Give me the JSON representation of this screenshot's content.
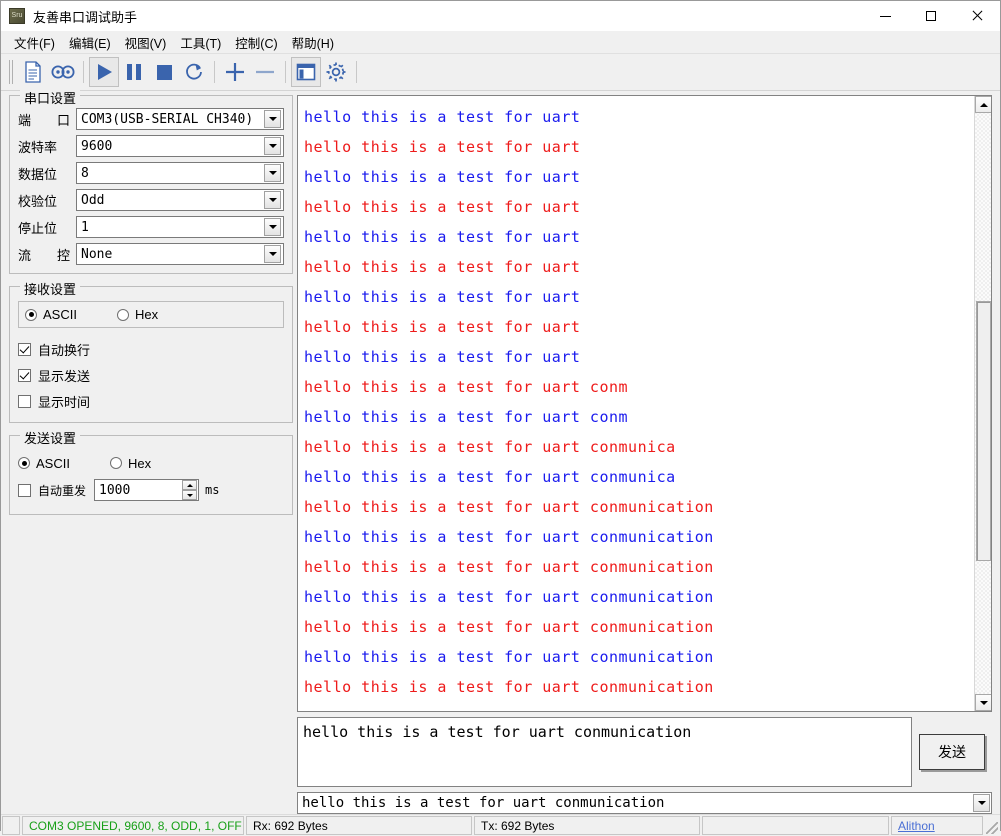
{
  "window": {
    "title": "友善串口调试助手",
    "icon": "app-icon",
    "minimize_label": "minimize",
    "maximize_label": "maximize",
    "close_label": "close"
  },
  "menubar": {
    "items": [
      {
        "label": "文件(F)",
        "name": "menu-file"
      },
      {
        "label": "编辑(E)",
        "name": "menu-edit"
      },
      {
        "label": "视图(V)",
        "name": "menu-view"
      },
      {
        "label": "工具(T)",
        "name": "menu-tools"
      },
      {
        "label": "控制(C)",
        "name": "menu-control"
      },
      {
        "label": "帮助(H)",
        "name": "menu-help"
      }
    ]
  },
  "toolbar": {
    "items": [
      {
        "icon": "new-file-icon",
        "active": false
      },
      {
        "icon": "serial-port-icon",
        "active": false
      },
      {
        "icon": "play-icon",
        "active": true
      },
      {
        "icon": "pause-icon",
        "active": false
      },
      {
        "icon": "stop-icon",
        "active": false
      },
      {
        "icon": "refresh-icon",
        "active": false
      },
      {
        "icon": "plus-icon",
        "active": false
      },
      {
        "icon": "minus-icon",
        "active": false
      },
      {
        "icon": "layout-icon",
        "active": true
      },
      {
        "icon": "gear-icon",
        "active": false
      }
    ]
  },
  "serial_settings": {
    "title": "串口设置",
    "fields": [
      {
        "label_left": "端",
        "label_right": "口",
        "value": "COM3(USB-SERIAL CH340)",
        "name": "port"
      },
      {
        "label_left": "波特率",
        "label_right": "",
        "value": "9600",
        "name": "baudrate"
      },
      {
        "label_left": "数据位",
        "label_right": "",
        "value": "8",
        "name": "databits"
      },
      {
        "label_left": "校验位",
        "label_right": "",
        "value": "Odd",
        "name": "parity"
      },
      {
        "label_left": "停止位",
        "label_right": "",
        "value": "1",
        "name": "stopbits"
      },
      {
        "label_left": "流",
        "label_right": "控",
        "value": "None",
        "name": "flowcontrol"
      }
    ]
  },
  "receive_settings": {
    "title": "接收设置",
    "format_ascii": "ASCII",
    "format_hex": "Hex",
    "format_selected": "ASCII",
    "checkboxes": [
      {
        "label": "自动换行",
        "checked": true,
        "name": "auto-wrap"
      },
      {
        "label": "显示发送",
        "checked": true,
        "name": "show-send"
      },
      {
        "label": "显示时间",
        "checked": false,
        "name": "show-time"
      }
    ]
  },
  "send_settings": {
    "title": "发送设置",
    "format_ascii": "ASCII",
    "format_hex": "Hex",
    "format_selected": "ASCII",
    "auto_resend_label": "自动重发",
    "auto_resend_checked": false,
    "interval_value": "1000",
    "interval_unit": "ms"
  },
  "terminal": {
    "rx_color": "#1a1aee",
    "tx_color": "#ee1a1a",
    "lines": [
      {
        "text": "hello this is a test for uart",
        "dir": "rx"
      },
      {
        "text": "hello this is a test for uart",
        "dir": "tx"
      },
      {
        "text": "hello this is a test for uart",
        "dir": "rx"
      },
      {
        "text": "hello this is a test for uart",
        "dir": "tx"
      },
      {
        "text": "hello this is a test for uart",
        "dir": "rx"
      },
      {
        "text": "hello this is a test for uart",
        "dir": "tx"
      },
      {
        "text": "hello this is a test for uart",
        "dir": "rx"
      },
      {
        "text": "hello this is a test for uart",
        "dir": "tx"
      },
      {
        "text": "hello this is a test for uart",
        "dir": "rx"
      },
      {
        "text": "hello this is a test for uart conm",
        "dir": "tx"
      },
      {
        "text": "hello this is a test for uart conm",
        "dir": "rx"
      },
      {
        "text": "hello this is a test for uart conmunica",
        "dir": "tx"
      },
      {
        "text": "hello this is a test for uart conmunica",
        "dir": "rx"
      },
      {
        "text": "hello this is a test for uart conmunication",
        "dir": "tx"
      },
      {
        "text": "hello this is a test for uart conmunication",
        "dir": "rx"
      },
      {
        "text": "hello this is a test for uart conmunication",
        "dir": "tx"
      },
      {
        "text": "hello this is a test for uart conmunication",
        "dir": "rx"
      },
      {
        "text": "hello this is a test for uart conmunication",
        "dir": "tx"
      },
      {
        "text": "hello this is a test for uart conmunication",
        "dir": "rx"
      },
      {
        "text": "hello this is a test for uart conmunication",
        "dir": "tx"
      }
    ]
  },
  "send": {
    "editor_value": "hello this is a test for uart conmunication",
    "button_label": "发送",
    "history_value": "hello this is a test for uart conmunication"
  },
  "statusbar": {
    "connection": "COM3 OPENED, 9600, 8, ODD, 1, OFF",
    "connection_color": "#18a018",
    "rx": "Rx: 692 Bytes",
    "tx": "Tx: 692 Bytes",
    "spacer": "",
    "link": "Alithon"
  }
}
